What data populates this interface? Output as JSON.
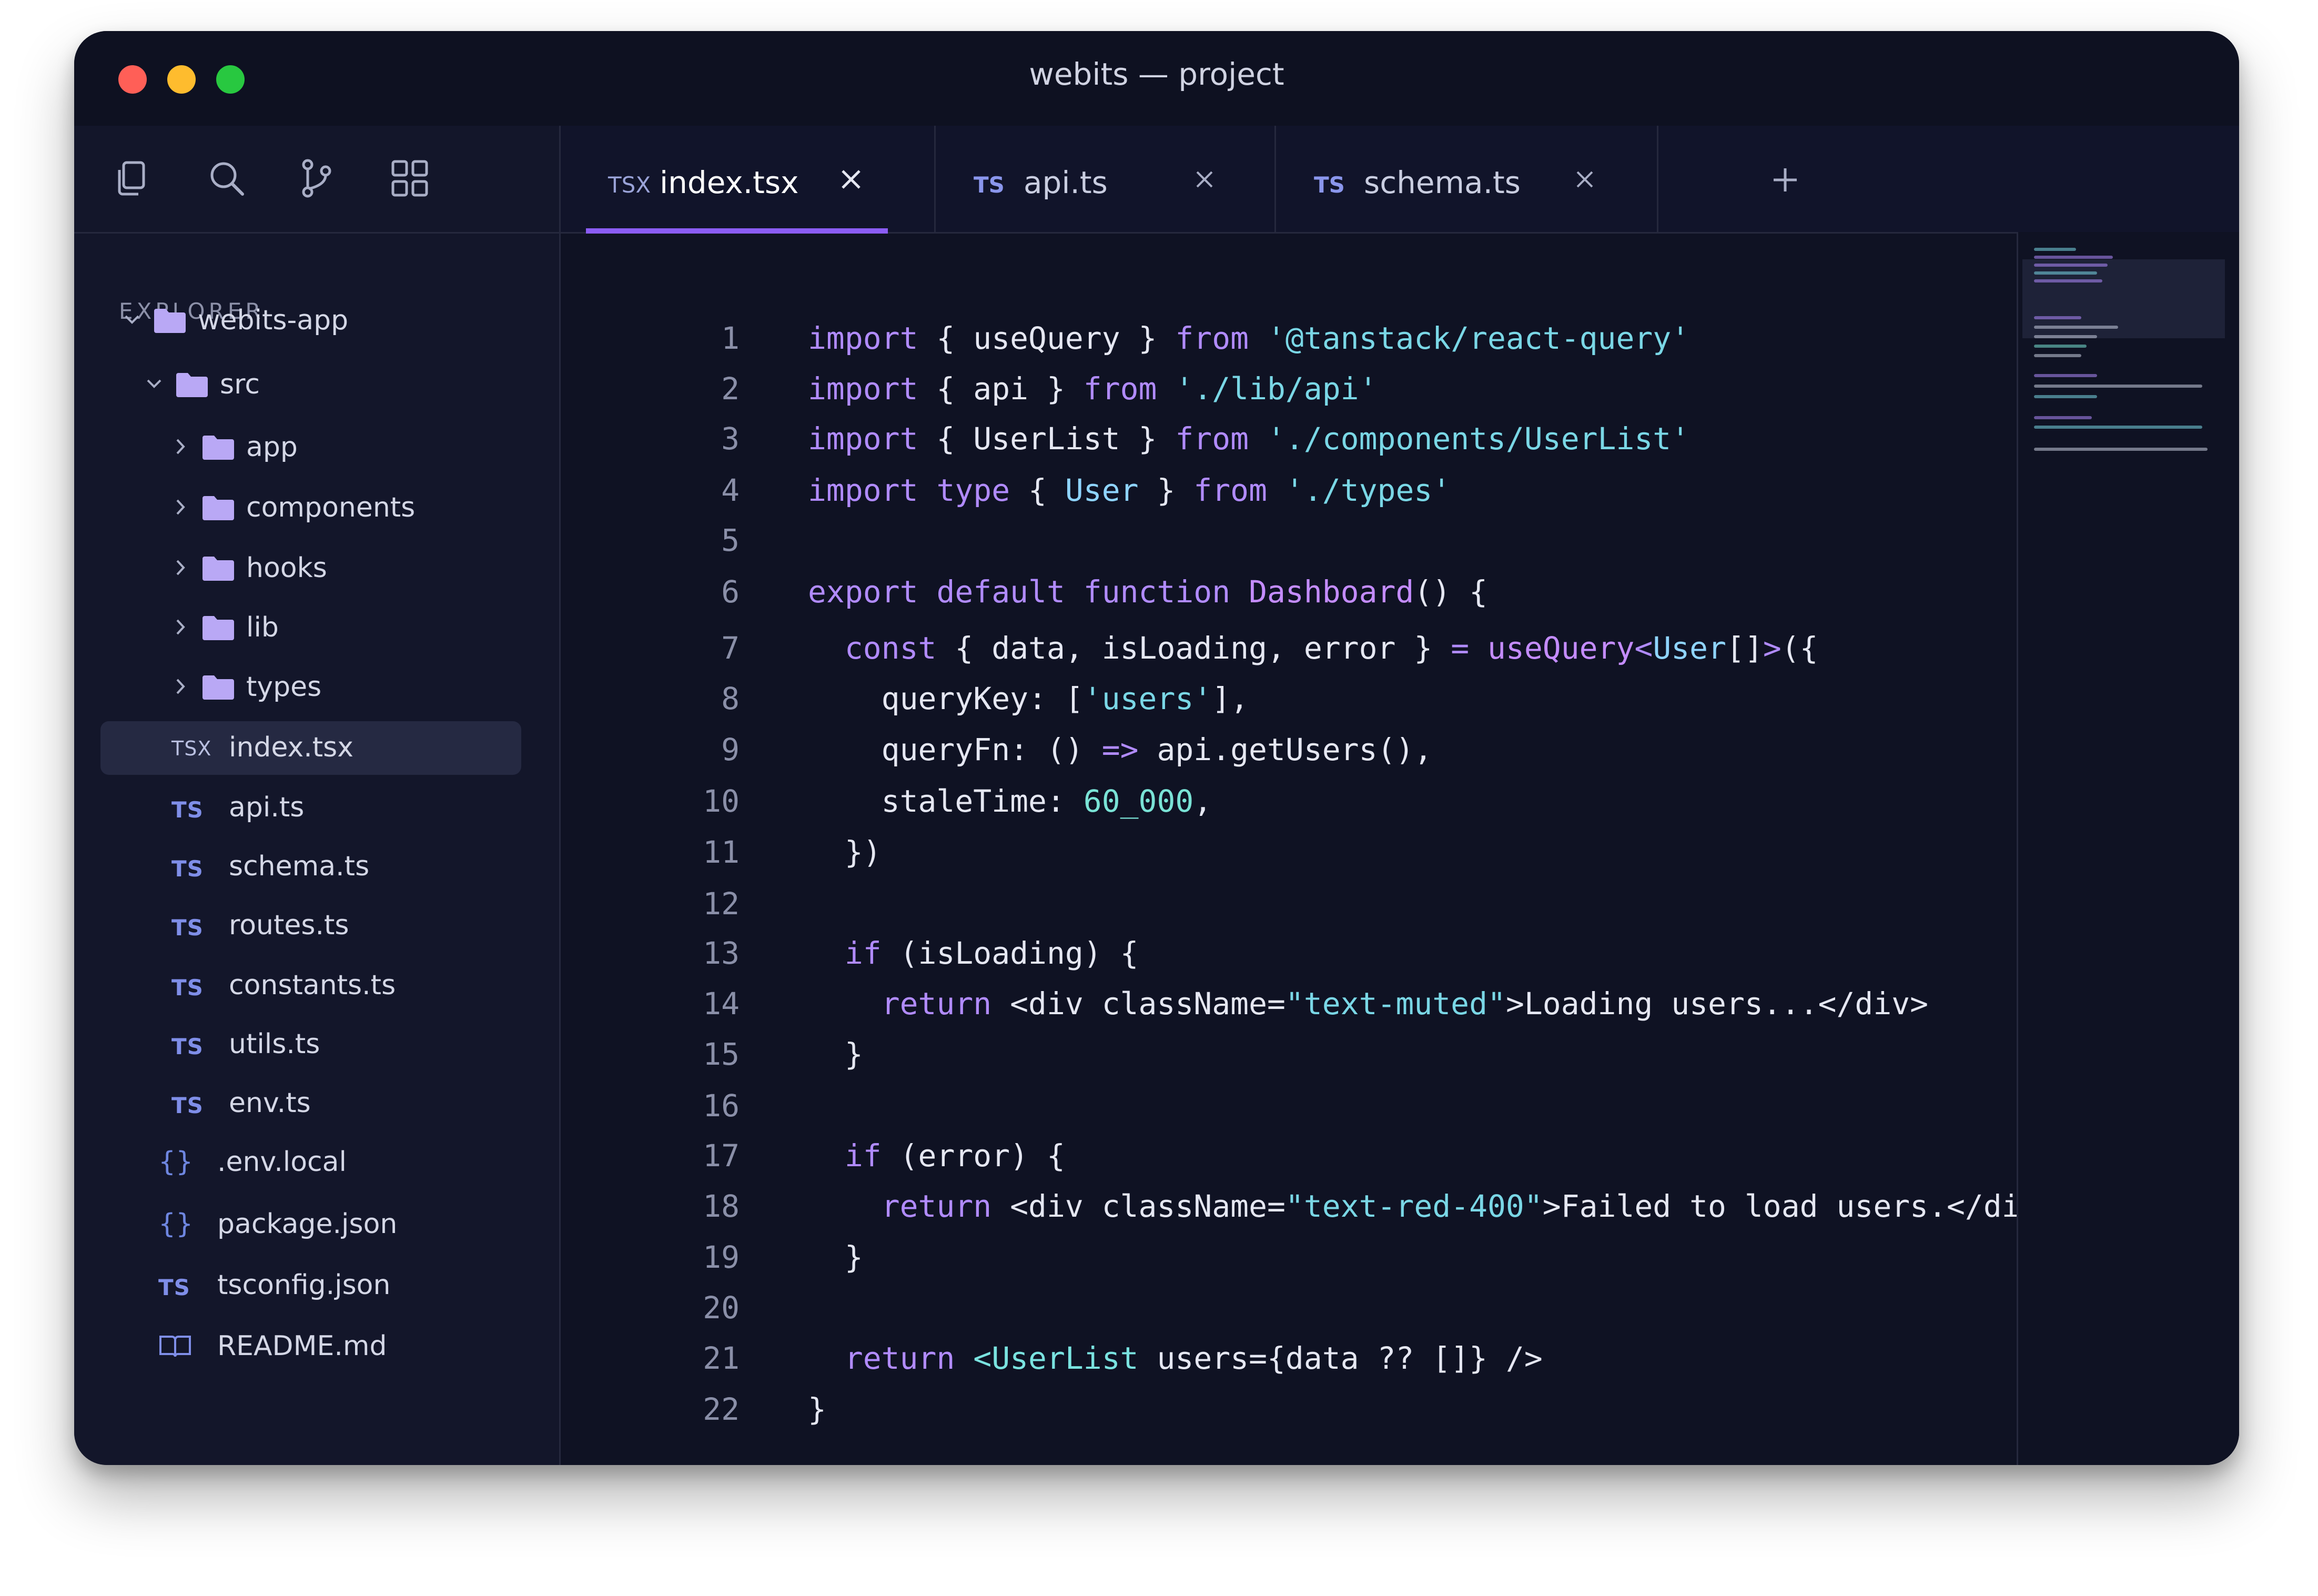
{
  "window": {
    "title": "webits — project"
  },
  "sidebar": {
    "toolbar_icons": [
      "files-icon",
      "search-icon",
      "source-control-icon",
      "extensions-icon"
    ],
    "explorer_label": "EXPLORER",
    "tree": [
      {
        "label": "webits-app",
        "kind": "folder",
        "expanded": true
      },
      {
        "label": "src",
        "kind": "folder",
        "expanded": true
      },
      {
        "label": "app",
        "kind": "folder",
        "expanded": false
      },
      {
        "label": "components",
        "kind": "folder",
        "expanded": false
      },
      {
        "label": "hooks",
        "kind": "folder",
        "expanded": false
      },
      {
        "label": "lib",
        "kind": "folder",
        "expanded": false
      },
      {
        "label": "types",
        "kind": "folder",
        "expanded": false
      },
      {
        "label": "index.tsx",
        "kind": "file",
        "badge": "TSX",
        "active": true
      },
      {
        "label": "api.ts",
        "kind": "file",
        "badge": "TS"
      },
      {
        "label": "schema.ts",
        "kind": "file",
        "badge": "TS"
      },
      {
        "label": "routes.ts",
        "kind": "file",
        "badge": "TS"
      },
      {
        "label": "constants.ts",
        "kind": "file",
        "badge": "TS"
      },
      {
        "label": "utils.ts",
        "kind": "file",
        "badge": "TS"
      },
      {
        "label": "env.ts",
        "kind": "file",
        "badge": "TS"
      },
      {
        "label": ".env.local",
        "kind": "file",
        "badge": "{}"
      },
      {
        "label": "package.json",
        "kind": "file",
        "badge": "{}"
      },
      {
        "label": "tsconfig.json",
        "kind": "file",
        "badge": "TS"
      },
      {
        "label": "README.md",
        "kind": "file",
        "badge": "book"
      }
    ]
  },
  "tabs": [
    {
      "badge": "TSX",
      "name": "index.tsx",
      "active": true
    },
    {
      "badge": "TS",
      "name": "api.ts",
      "active": false
    },
    {
      "badge": "TS",
      "name": "schema.ts",
      "active": false
    }
  ],
  "code": {
    "line_numbers": [
      "1",
      "2",
      "3",
      "4",
      "5",
      "6",
      "7",
      "8",
      "9",
      "10",
      "11",
      "12",
      "13",
      "14",
      "15",
      "16",
      "17",
      "18",
      "19",
      "20",
      "21",
      "22"
    ],
    "lines": [
      [
        [
          "kw",
          "import"
        ],
        [
          "pn",
          " { useQuery } "
        ],
        [
          "kw",
          "from"
        ],
        [
          "pn",
          " "
        ],
        [
          "str",
          "'@tanstack/react-query'"
        ]
      ],
      [
        [
          "kw",
          "import"
        ],
        [
          "pn",
          " { api } "
        ],
        [
          "kw",
          "from"
        ],
        [
          "pn",
          " "
        ],
        [
          "str",
          "'./lib/api'"
        ]
      ],
      [
        [
          "kw",
          "import"
        ],
        [
          "pn",
          " { UserList } "
        ],
        [
          "kw",
          "from"
        ],
        [
          "pn",
          " "
        ],
        [
          "str",
          "'./components/UserList'"
        ]
      ],
      [
        [
          "kw",
          "import"
        ],
        [
          "pn",
          " "
        ],
        [
          "kw",
          "type"
        ],
        [
          "pn",
          " { "
        ],
        [
          "ty",
          "User"
        ],
        [
          "pn",
          " } "
        ],
        [
          "kw",
          "from"
        ],
        [
          "pn",
          " "
        ],
        [
          "str",
          "'./types'"
        ]
      ],
      [],
      [
        [
          "kw",
          "export"
        ],
        [
          "pn",
          " "
        ],
        [
          "kw",
          "default"
        ],
        [
          "pn",
          " "
        ],
        [
          "kw",
          "function"
        ],
        [
          "pn",
          " "
        ],
        [
          "fn",
          "Dashboard"
        ],
        [
          "pn",
          "() {"
        ]
      ],
      [
        [
          "pn",
          "  "
        ],
        [
          "kw",
          "const"
        ],
        [
          "pn",
          " { data, isLoading, error } "
        ],
        [
          "kw",
          "="
        ],
        [
          "pn",
          " "
        ],
        [
          "fn",
          "useQuery"
        ],
        [
          "kw",
          "<"
        ],
        [
          "ty",
          "User"
        ],
        [
          "pn",
          "[]"
        ],
        [
          "kw",
          ">"
        ],
        [
          "pn",
          "({"
        ]
      ],
      [
        [
          "pn",
          "    queryKey: ["
        ],
        [
          "str",
          "'users'"
        ],
        [
          "pn",
          "],"
        ]
      ],
      [
        [
          "pn",
          "    queryFn: () "
        ],
        [
          "kw",
          "=>"
        ],
        [
          "pn",
          " api.getUsers(),"
        ]
      ],
      [
        [
          "pn",
          "    staleTime: "
        ],
        [
          "num",
          "60_000"
        ],
        [
          "pn",
          ","
        ]
      ],
      [
        [
          "pn",
          "  })"
        ]
      ],
      [],
      [
        [
          "pn",
          "  "
        ],
        [
          "kw",
          "if"
        ],
        [
          "pn",
          " (isLoading) {"
        ]
      ],
      [
        [
          "pn",
          "    "
        ],
        [
          "kw",
          "return"
        ],
        [
          "pn",
          " <div className="
        ],
        [
          "str",
          "\"text-muted\""
        ],
        [
          "pn",
          ">Loading users...</div>"
        ]
      ],
      [
        [
          "pn",
          "  }"
        ]
      ],
      [],
      [
        [
          "pn",
          "  "
        ],
        [
          "kw",
          "if"
        ],
        [
          "pn",
          " (error) {"
        ]
      ],
      [
        [
          "pn",
          "    "
        ],
        [
          "kw",
          "return"
        ],
        [
          "pn",
          " <div className="
        ],
        [
          "str",
          "\"text-red-400\""
        ],
        [
          "pn",
          ">Failed to load users.</div>"
        ]
      ],
      [
        [
          "pn",
          "  }"
        ]
      ],
      [],
      [
        [
          "pn",
          "  "
        ],
        [
          "kw",
          "return"
        ],
        [
          "pn",
          " "
        ],
        [
          "cm",
          "<UserList"
        ],
        [
          "pn",
          " users={data ?? []} />"
        ]
      ],
      [
        [
          "pn",
          "}"
        ]
      ]
    ]
  },
  "colors": {
    "accent": "#8b5cf6",
    "background": "#0f1223",
    "sidebar": "#13162a",
    "folder": "#b9a8f5"
  }
}
